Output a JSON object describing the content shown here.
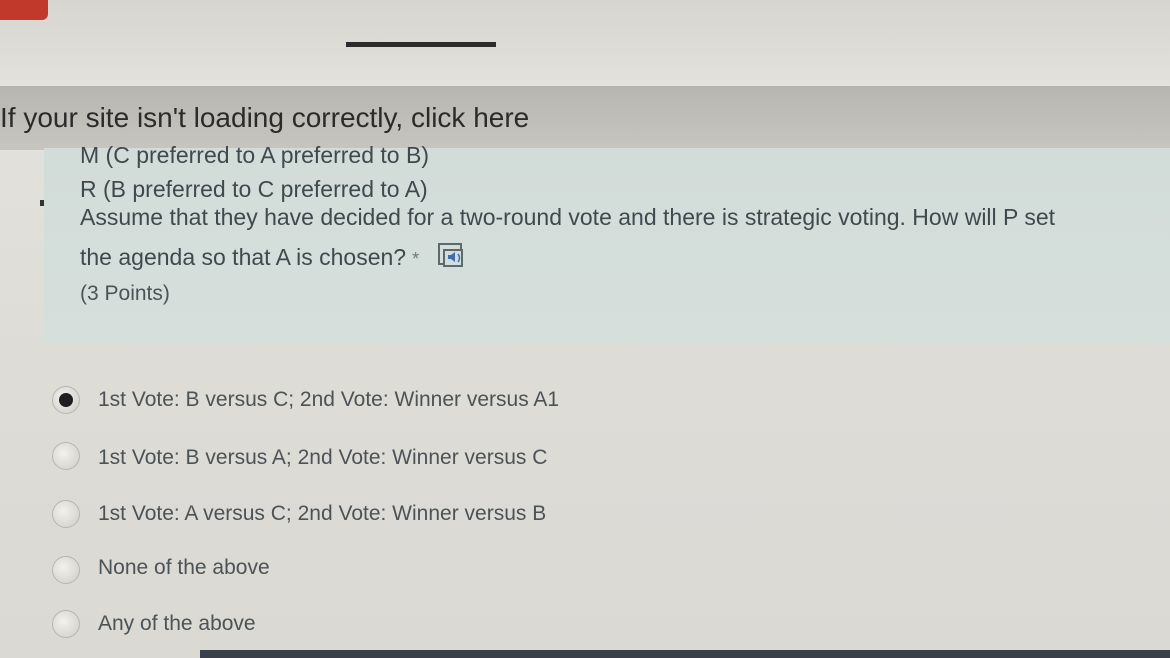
{
  "notice": {
    "text": "If your site isn't loading correctly, click here"
  },
  "question": {
    "lines": [
      "M (C preferred to A preferred to B)",
      "R (B preferred to C preferred to A)",
      "Assume that they have decided for a two-round vote and there is strategic voting. How will P set",
      "the agenda so that A is chosen?"
    ],
    "required_marker": "*",
    "points": "(3 Points)",
    "audio_icon": "immersive-reader-speaker-icon"
  },
  "options": [
    {
      "label": "1st Vote: B versus C; 2nd Vote: Winner versus A1",
      "selected": true
    },
    {
      "label": "1st Vote: B versus A; 2nd Vote: Winner versus C",
      "selected": false
    },
    {
      "label": "1st Vote: A versus C; 2nd Vote: Winner versus B",
      "selected": false
    },
    {
      "label": "None of the above",
      "selected": false
    },
    {
      "label": "Any of the above",
      "selected": false
    }
  ],
  "colors": {
    "card_background": "#d4ddda",
    "notice_background": "#bebcb6",
    "text": "#3f4a4e"
  }
}
